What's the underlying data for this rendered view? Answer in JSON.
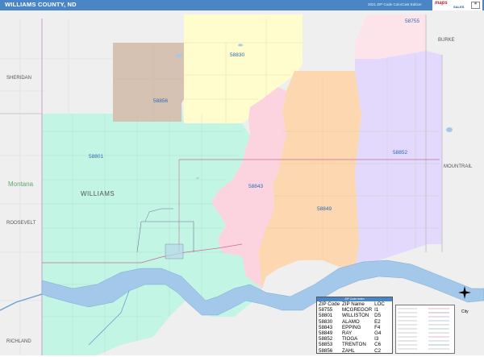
{
  "header": {
    "title": "WILLIAMS COUNTY, ND",
    "edition": "2021 ZIP Code ColorCast Edition",
    "logo_text": "maps",
    "logo_sub": "SALES"
  },
  "map": {
    "county_labels": [
      "SHERIDAN",
      "BURKE",
      "MOUNTRAIL",
      "ROOSEVELT",
      "RICHLAND",
      "WILLIAMS"
    ],
    "state_label": "Montana",
    "zip_labels": [
      "58755",
      "58830",
      "58856",
      "58801",
      "58852",
      "58843",
      "58849"
    ],
    "colors": {
      "mint": "#c2f5e4",
      "yellow": "#fffccd",
      "brown": "#d6c2b2",
      "pink": "#fbd4df",
      "peach": "#fcd7b0",
      "lavender": "#e2d9fc",
      "light_pink": "#fde3ea",
      "outside": "#eeeeee",
      "river": "#a3c8ea",
      "accent": "#4a86c5"
    }
  },
  "legend": {
    "title": "ZIP Code Index",
    "headers": [
      "ZIP Code",
      "ZIP Name",
      "LOC"
    ],
    "rows": [
      [
        "58755",
        "MCGREGOR",
        "I1"
      ],
      [
        "58801",
        "WILLISTON",
        "D5"
      ],
      [
        "58830",
        "ALAMO",
        "E2"
      ],
      [
        "58843",
        "EPPING",
        "F4"
      ],
      [
        "58849",
        "RAY",
        "G4"
      ],
      [
        "58852",
        "TIOGA",
        "I3"
      ],
      [
        "58853",
        "TRENTON",
        "C6"
      ],
      [
        "58856",
        "ZAHL",
        "C2"
      ]
    ]
  },
  "scale": {
    "city_label": "City"
  },
  "icons": {
    "compass": "compass-rose-icon",
    "logo": "map-sales-logo-icon"
  }
}
